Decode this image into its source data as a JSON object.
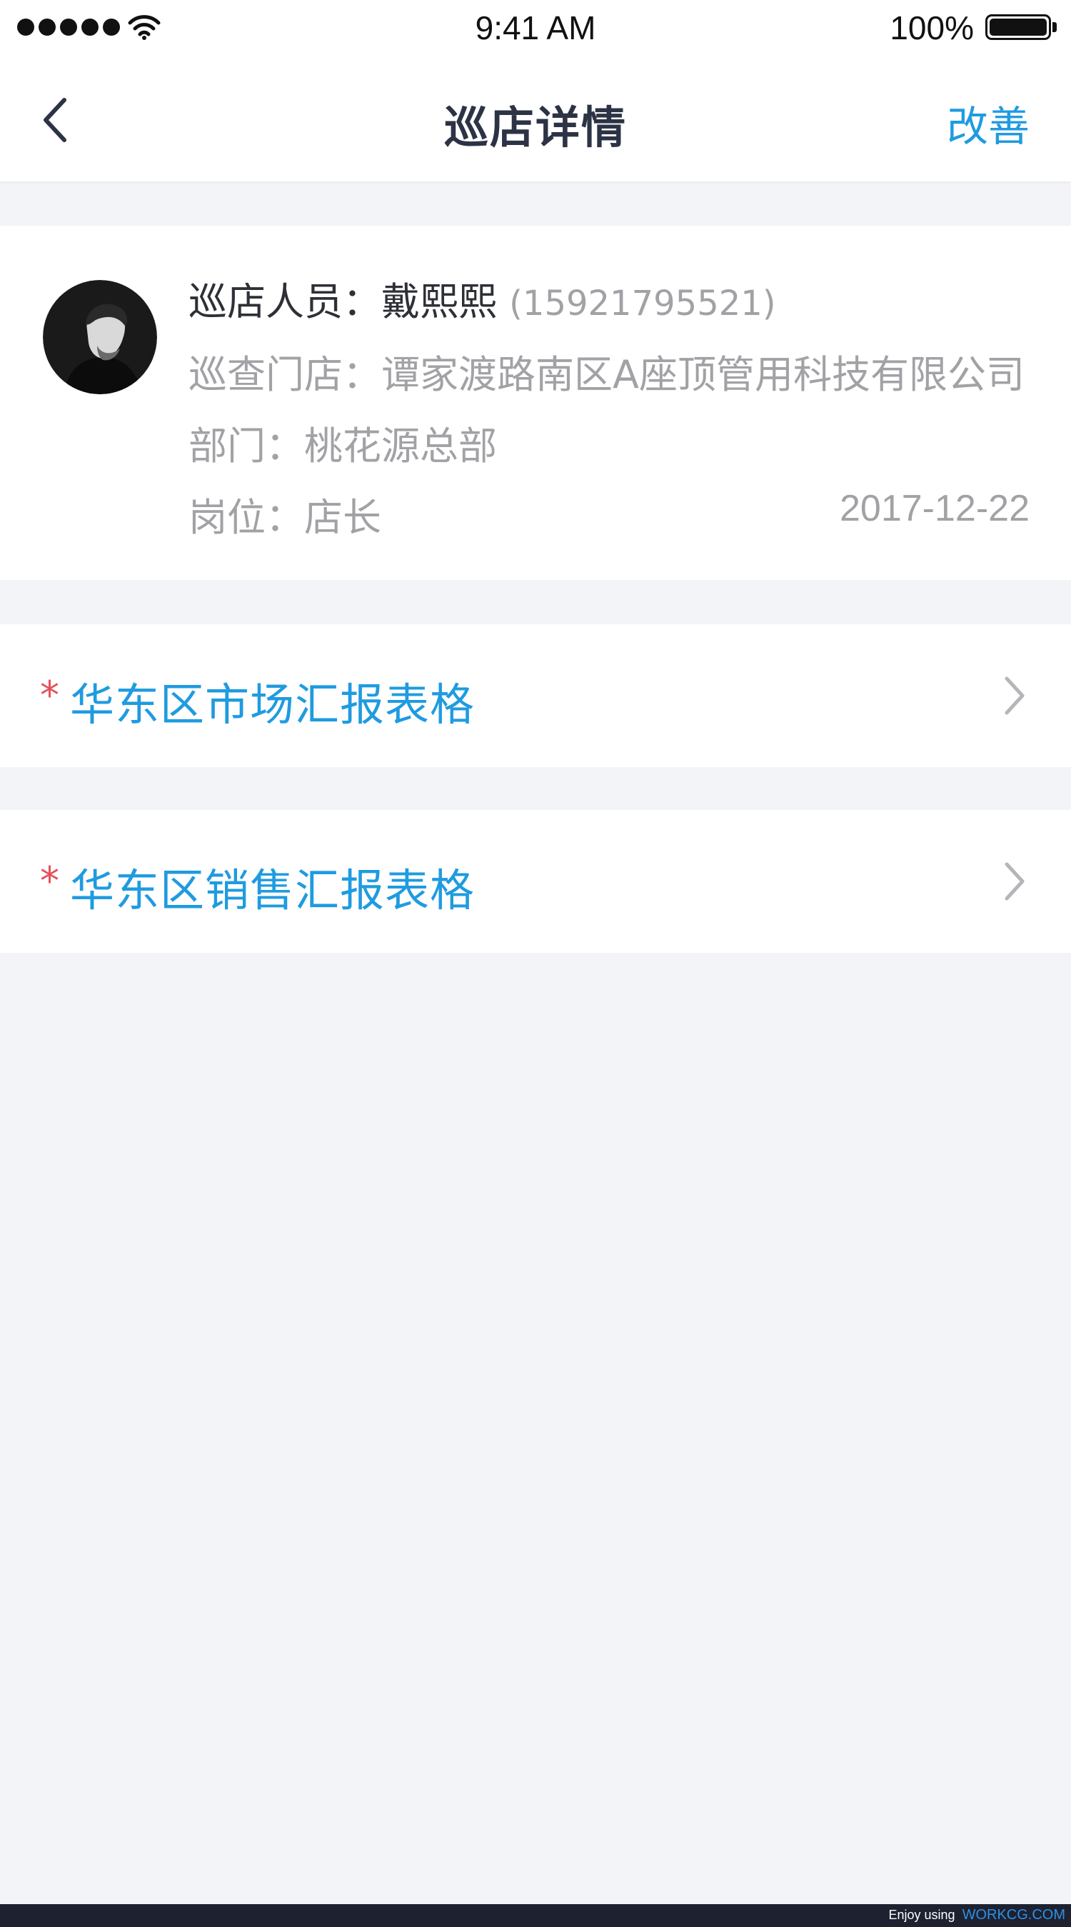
{
  "status_bar": {
    "time": "9:41 AM",
    "battery": "100%"
  },
  "nav": {
    "title": "巡店详情",
    "action": "改善"
  },
  "inspection": {
    "inspector_label": "巡店人员：",
    "inspector_name": "戴熙熙",
    "phone": "(15921795521)",
    "store_label": "巡查门店：",
    "store": "谭家渡路南区A座顶管用科技有限公司",
    "dept_label": "部门：",
    "dept": "桃花源总部",
    "post_label": "岗位：",
    "post": "店长",
    "date": "2017-12-22"
  },
  "reports": [
    {
      "required": "*",
      "label": "华东区市场汇报表格"
    },
    {
      "required": "*",
      "label": "华东区销售汇报表格"
    }
  ],
  "watermark": {
    "prefix": "Enjoy using",
    "brand": "WORKCG.COM"
  },
  "colors": {
    "accent": "#1f9be0",
    "required": "#e5505a",
    "background": "#f3f4f8",
    "muted_text": "#a2a2a6"
  }
}
